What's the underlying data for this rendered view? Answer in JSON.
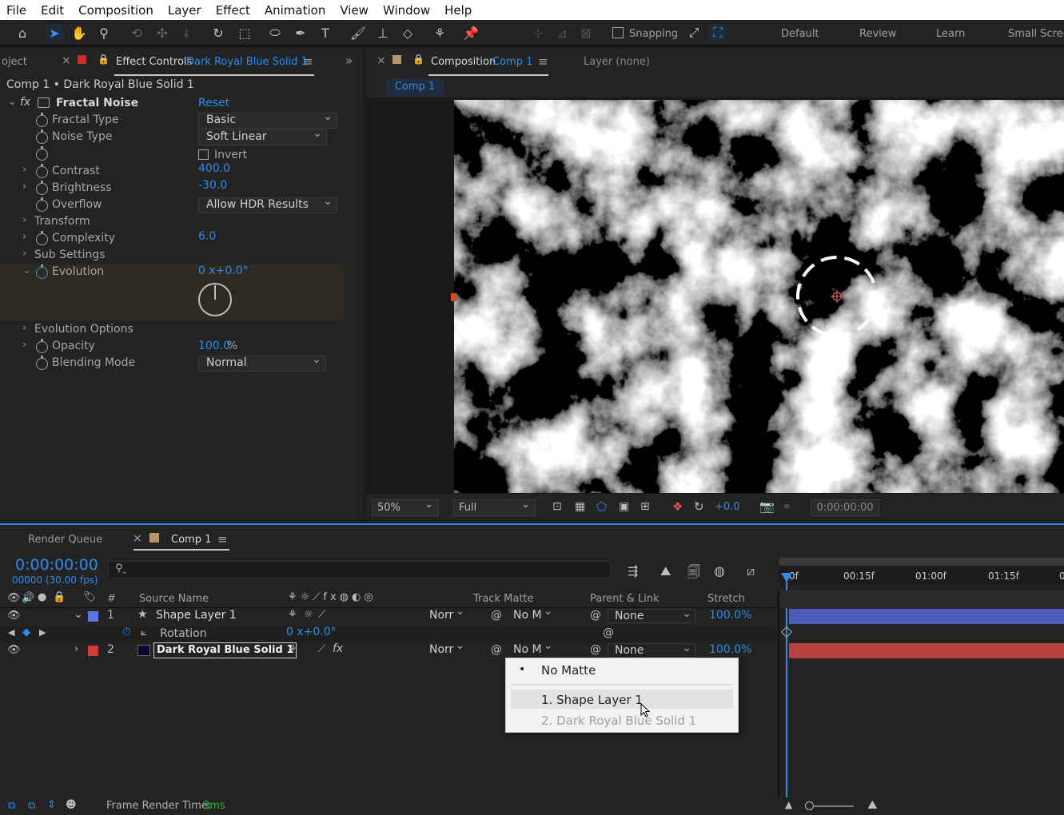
{
  "menu": [
    "File",
    "Edit",
    "Composition",
    "Layer",
    "Effect",
    "Animation",
    "View",
    "Window",
    "Help"
  ],
  "toolbar": {
    "snapping_label": "Snapping",
    "workspaces": [
      "Default",
      "Review",
      "Learn",
      "Small Scree"
    ]
  },
  "effect_controls": {
    "project_tab": "oject",
    "tab_label": "Effect Controls",
    "tab_layer": "Dark Royal Blue Solid 1",
    "breadcrumb": "Comp 1 • Dark Royal Blue Solid 1",
    "effect_name": "Fractal Noise",
    "reset_label": "Reset",
    "fractal_type_label": "Fractal Type",
    "fractal_type_value": "Basic",
    "noise_type_label": "Noise Type",
    "noise_type_value": "Soft Linear",
    "invert_label": "Invert",
    "contrast_label": "Contrast",
    "contrast_value": "400.0",
    "brightness_label": "Brightness",
    "brightness_value": "-30.0",
    "overflow_label": "Overflow",
    "overflow_value": "Allow HDR Results",
    "transform_label": "Transform",
    "complexity_label": "Complexity",
    "complexity_value": "6.0",
    "sub_settings_label": "Sub Settings",
    "evolution_label": "Evolution",
    "evolution_value": "0 x+0.0°",
    "evolution_options_label": "Evolution Options",
    "opacity_label": "Opacity",
    "opacity_value": "100.0",
    "opacity_unit": "%",
    "blending_label": "Blending Mode",
    "blending_value": "Normal"
  },
  "composition": {
    "tab_label": "Composition",
    "tab_comp": "Comp 1",
    "layer_tab": "Layer (none)",
    "comp_button": "Comp 1",
    "zoom": "50%",
    "resolution": "Full",
    "exposure": "+0.0",
    "timecode": "0:00:00:00"
  },
  "timeline": {
    "render_queue_tab": "Render Queue",
    "comp_tab": "Comp 1",
    "current_time": "0:00:00:00",
    "frames": "00000 (30.00 fps)",
    "ruler": [
      "0f",
      "00:15f",
      "01:00f",
      "01:15f",
      "0"
    ],
    "headers": {
      "num": "#",
      "source": "Source Name",
      "track_matte": "Track Matte",
      "parent": "Parent & Link",
      "stretch": "Stretch"
    },
    "layers": [
      {
        "num": "1",
        "name": "Shape Layer 1",
        "mode": "Norr",
        "matte": "No M",
        "parent": "None",
        "stretch": "100.0%",
        "label_color": "#5b76e0"
      },
      {
        "num": "2",
        "name": "Dark Royal Blue Solid 1",
        "mode": "Norr",
        "matte": "No M",
        "parent": "None",
        "stretch": "100.0%",
        "label_color": "#d23a3a"
      }
    ],
    "rotation_label": "Rotation",
    "rotation_value": "0 x+0.0°"
  },
  "matte_menu": {
    "items": [
      "No Matte",
      "1. Shape Layer 1",
      "2. Dark Royal Blue Solid 1"
    ]
  },
  "status": {
    "label": "Frame Render Time:",
    "value": "3ms"
  }
}
